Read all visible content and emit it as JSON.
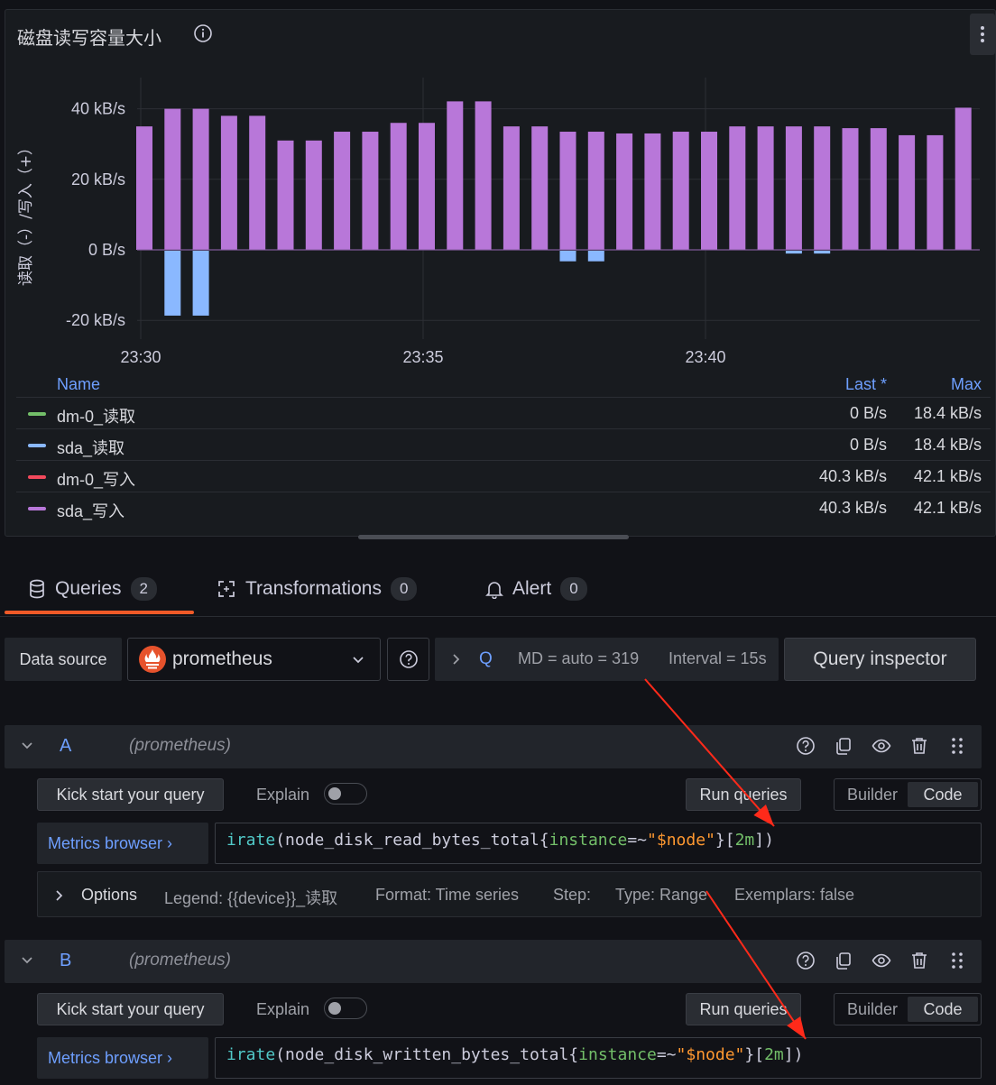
{
  "panel": {
    "title": "磁盘读写容量大小"
  },
  "chart_data": {
    "type": "bar",
    "ylabel": "读取（-）/写入（+）",
    "y_ticks": [
      "40 kB/s",
      "20 kB/s",
      "0 B/s",
      "-20 kB/s"
    ],
    "y_tick_values": [
      40,
      20,
      0,
      -20
    ],
    "x_ticks": [
      "23:30",
      "23:35",
      "23:40"
    ],
    "x_tick_times": [
      "23:30",
      "23:35",
      "23:40"
    ],
    "ylim": [
      -26,
      46
    ],
    "x_time_range": [
      "23:29:30",
      "23:44:30"
    ],
    "unit": "kB/s",
    "x": [
      "23:30:00",
      "23:30:30",
      "23:31:00",
      "23:31:30",
      "23:32:00",
      "23:32:30",
      "23:33:00",
      "23:33:30",
      "23:34:00",
      "23:34:30",
      "23:35:00",
      "23:35:30",
      "23:36:00",
      "23:36:30",
      "23:37:00",
      "23:37:30",
      "23:38:00",
      "23:38:30",
      "23:39:00",
      "23:39:30",
      "23:40:00",
      "23:40:30",
      "23:41:00",
      "23:41:30",
      "23:42:00",
      "23:42:30",
      "23:43:00",
      "23:43:30",
      "23:44:00",
      "23:44:30"
    ],
    "series": [
      {
        "name": "sda_写入",
        "color": "#b877d9",
        "values": [
          35,
          40,
          40,
          38,
          38,
          31,
          31,
          33.5,
          33.5,
          36,
          36,
          42.1,
          42.1,
          35,
          35,
          33.5,
          33.5,
          33,
          33,
          33.5,
          33.5,
          35,
          35,
          35,
          35,
          34.5,
          34.5,
          32.5,
          32.5,
          40.3
        ]
      },
      {
        "name": "sda_读取",
        "color": "#8ab8ff",
        "values": [
          0,
          -18.4,
          -18.4,
          0,
          0,
          0,
          0,
          0,
          0,
          0,
          0,
          0,
          0,
          0,
          0,
          -3,
          -3,
          0,
          0,
          0,
          0,
          0,
          0,
          -0.8,
          -0.8,
          0,
          0,
          0,
          0,
          0
        ]
      },
      {
        "name": "dm-0_读取",
        "color": "#73bf69",
        "values": [
          0,
          -18.4,
          -18.4,
          0,
          0,
          0,
          0,
          0,
          0,
          0,
          0,
          0,
          0,
          0,
          0,
          -3,
          -3,
          0,
          0,
          0,
          0,
          0,
          0,
          -0.8,
          -0.8,
          0,
          0,
          0,
          0,
          0
        ]
      },
      {
        "name": "dm-0_写入",
        "color": "#f2495c",
        "values": [
          35,
          40,
          40,
          38,
          38,
          31,
          31,
          33.5,
          33.5,
          36,
          36,
          42.1,
          42.1,
          35,
          35,
          33.5,
          33.5,
          33,
          33,
          33.5,
          33.5,
          35,
          35,
          35,
          35,
          34.5,
          34.5,
          32.5,
          32.5,
          40.3
        ]
      }
    ],
    "legend": {
      "headers": {
        "name": "Name",
        "last": "Last *",
        "max": "Max"
      },
      "rows": [
        {
          "name": "dm-0_读取",
          "color": "#73bf69",
          "last": "0 B/s",
          "max": "18.4 kB/s"
        },
        {
          "name": "sda_读取",
          "color": "#8ab8ff",
          "last": "0 B/s",
          "max": "18.4 kB/s"
        },
        {
          "name": "dm-0_写入",
          "color": "#f2495c",
          "last": "40.3 kB/s",
          "max": "42.1 kB/s"
        },
        {
          "name": "sda_写入",
          "color": "#b877d9",
          "last": "40.3 kB/s",
          "max": "42.1 kB/s"
        }
      ]
    }
  },
  "tabs": [
    {
      "label": "Queries",
      "count": "2",
      "icon": "database-icon"
    },
    {
      "label": "Transformations",
      "count": "0",
      "icon": "transform-icon"
    },
    {
      "label": "Alert",
      "count": "0",
      "icon": "bell-icon"
    }
  ],
  "datasource": {
    "label": "Data source",
    "value": "prometheus",
    "options_q": "Q",
    "md": "MD = auto = 319",
    "interval": "Interval = 15s",
    "inspector": "Query inspector"
  },
  "queries": [
    {
      "ref": "A",
      "ds": "(prometheus)",
      "kick": "Kick start your query",
      "explain": "Explain",
      "run": "Run queries",
      "builder": "Builder",
      "code": "Code",
      "browser": "Metrics browser ›",
      "expr": {
        "fn": "irate",
        "p1": "(node_disk_read_bytes_total{",
        "label": "instance",
        "op": "=~",
        "str": "\"$node\"",
        "p2": "}[",
        "dur": "2m",
        "p3": "])"
      },
      "options": {
        "title": "Options",
        "legend": "Legend: {{device}}_读取",
        "format": "Format: Time series",
        "step": "Step:",
        "type": "Type: Range",
        "exemplars": "Exemplars: false"
      }
    },
    {
      "ref": "B",
      "ds": "(prometheus)",
      "kick": "Kick start your query",
      "explain": "Explain",
      "run": "Run queries",
      "builder": "Builder",
      "code": "Code",
      "browser": "Metrics browser ›",
      "expr": {
        "fn": "irate",
        "p1": "(node_disk_written_bytes_total{",
        "label": "instance",
        "op": "=~",
        "str": "\"$node\"",
        "p2": "}[",
        "dur": "2m",
        "p3": "])"
      }
    }
  ],
  "colors": {
    "accent": "#f05a28",
    "link": "#6e9fff",
    "annotation_arrow": "#ff2a1a"
  }
}
